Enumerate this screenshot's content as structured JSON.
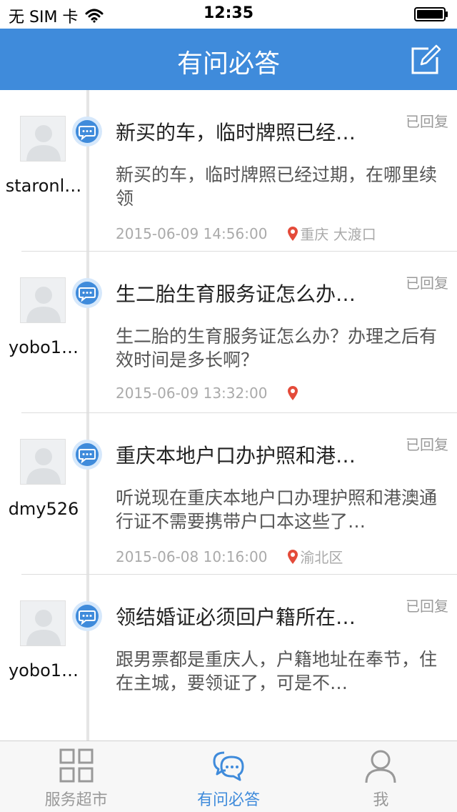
{
  "status_bar": {
    "carrier": "无 SIM 卡",
    "time": "12:35",
    "wifi_icon": "wifi-icon",
    "battery_icon": "battery-icon"
  },
  "header": {
    "title": "有问必答",
    "compose_icon": "compose-icon"
  },
  "feed": {
    "items": [
      {
        "username": "staronl…",
        "title": "新买的车，临时牌照已经…",
        "status": "已回复",
        "content": "新买的车，临时牌照已经过期，在哪里续领",
        "datetime": "2015-06-09 14:56:00",
        "location": "重庆 大渡口"
      },
      {
        "username": "yobo1…",
        "title": "生二胎生育服务证怎么办…",
        "status": "已回复",
        "content": "生二胎的生育服务证怎么办？办理之后有效时间是多长啊？",
        "datetime": "2015-06-09 13:32:00",
        "location": ""
      },
      {
        "username": "dmy526",
        "title": "重庆本地户口办护照和港…",
        "status": "已回复",
        "content": "听说现在重庆本地户口办理护照和港澳通行证不需要携带户口本这些了…",
        "datetime": "2015-06-08 10:16:00",
        "location": "渝北区"
      },
      {
        "username": "yobo1…",
        "title": "领结婚证必须回户籍所在…",
        "status": "已回复",
        "content": "跟男票都是重庆人，户籍地址在奉节，住在主城，要领证了，可是不…",
        "datetime": "",
        "location": ""
      }
    ]
  },
  "tab_bar": {
    "tabs": [
      {
        "label": "服务超市",
        "icon": "grid-icon",
        "active": false
      },
      {
        "label": "有问必答",
        "icon": "chat-bubbles-icon",
        "active": true
      },
      {
        "label": "我",
        "icon": "person-icon",
        "active": false
      }
    ]
  },
  "colors": {
    "brand": "#3f8bdb",
    "tab_active": "#3f8bdb",
    "tab_inactive": "#999999",
    "meta_text": "#aaaaaa",
    "pin": "#e44b3a"
  }
}
